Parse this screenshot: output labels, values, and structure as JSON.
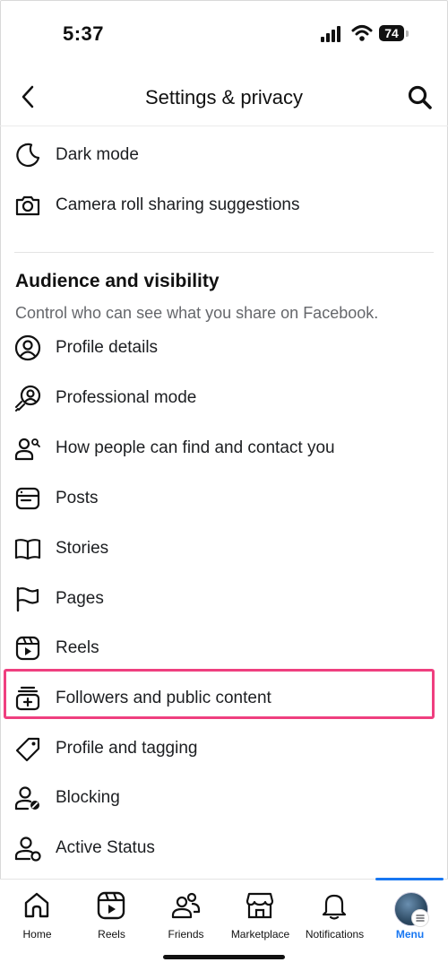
{
  "status_bar": {
    "time": "5:37",
    "battery": "74"
  },
  "header": {
    "title": "Settings & privacy"
  },
  "preferences": {
    "items": [
      {
        "label": "Dark mode",
        "icon": "moon-icon"
      },
      {
        "label": "Camera roll sharing suggestions",
        "icon": "camera-icon"
      }
    ]
  },
  "audience": {
    "title": "Audience and visibility",
    "subtitle": "Control who can see what you share on Facebook.",
    "items": [
      {
        "label": "Profile details",
        "icon": "profile-circle-icon"
      },
      {
        "label": "Professional mode",
        "icon": "professional-mode-icon"
      },
      {
        "label": "How people can find and contact you",
        "icon": "find-contact-icon"
      },
      {
        "label": "Posts",
        "icon": "posts-icon"
      },
      {
        "label": "Stories",
        "icon": "book-icon"
      },
      {
        "label": "Pages",
        "icon": "flag-icon"
      },
      {
        "label": "Reels",
        "icon": "reels-icon"
      },
      {
        "label": "Followers and public content",
        "icon": "followers-icon"
      },
      {
        "label": "Profile and tagging",
        "icon": "tag-icon"
      },
      {
        "label": "Blocking",
        "icon": "blocking-icon"
      },
      {
        "label": "Active Status",
        "icon": "active-status-icon"
      }
    ]
  },
  "highlight_color": "#ef3f7f",
  "bottom_nav": {
    "items": [
      {
        "label": "Home",
        "icon": "home-icon"
      },
      {
        "label": "Reels",
        "icon": "reels-icon"
      },
      {
        "label": "Friends",
        "icon": "friends-icon"
      },
      {
        "label": "Marketplace",
        "icon": "marketplace-icon"
      },
      {
        "label": "Notifications",
        "icon": "bell-icon"
      },
      {
        "label": "Menu",
        "icon": "avatar-menu-icon",
        "active": true
      }
    ],
    "accent_color": "#1877f2"
  }
}
